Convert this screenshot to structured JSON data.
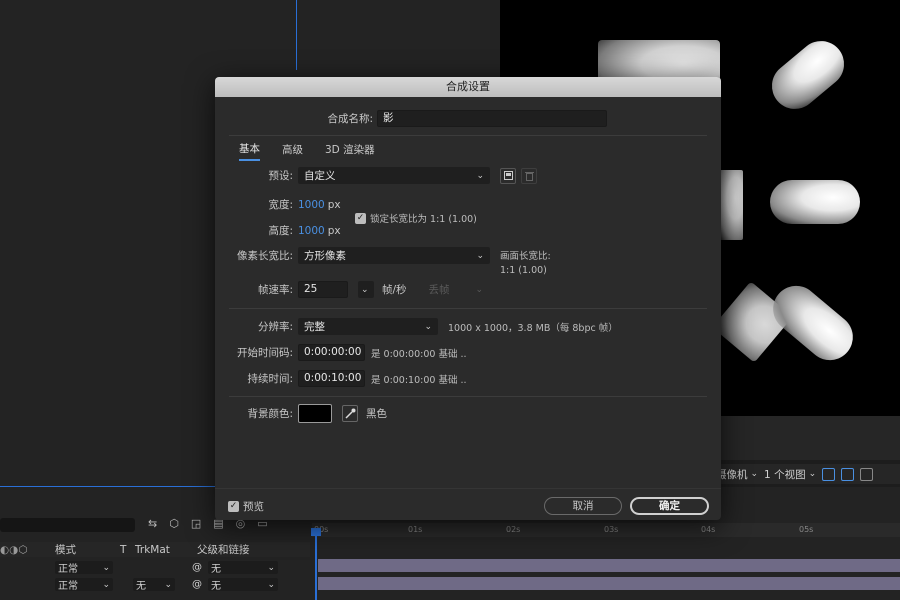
{
  "dialog": {
    "title": "合成设置",
    "name_label": "合成名称:",
    "name_value": "影",
    "tabs": [
      "基本",
      "高级",
      "3D 渲染器"
    ],
    "preset_label": "预设:",
    "preset_value": "自定义",
    "width_label": "宽度:",
    "width_value": "1000",
    "height_label": "高度:",
    "height_value": "1000",
    "unit_px": "px",
    "lock_label": "锁定长宽比为 1:1 (1.00)",
    "pixel_aspect_label": "像素长宽比:",
    "pixel_aspect_value": "方形像素",
    "frame_aspect_label": "画面长宽比:",
    "frame_aspect_value": "1:1 (1.00)",
    "framerate_label": "帧速率:",
    "framerate_value": "25",
    "framerate_unit": "帧/秒",
    "drop_frame_value": "丢帧",
    "resolution_label": "分辨率:",
    "resolution_value": "完整",
    "resolution_info": "1000 x 1000，3.8 MB（每 8bpc 帧）",
    "start_tc_label": "开始时间码:",
    "start_tc_value": "0:00:00:00",
    "start_tc_info": "是 0:00:00:00  基础 ..",
    "duration_label": "持续时间:",
    "duration_value": "0:00:10:00",
    "duration_info": "是 0:00:10:00  基础 ..",
    "bg_color_label": "背景颜色:",
    "bg_color_name": "黑色",
    "bg_color_hex": "#000000",
    "preview_label": "预览",
    "cancel_label": "取消",
    "ok_label": "确定"
  },
  "viewer": {
    "camera_label": "摄像机",
    "views_label": "1 个视图"
  },
  "timeline": {
    "ruler": [
      "00s",
      "01s",
      "02s",
      "03s",
      "04s",
      "05s"
    ],
    "col_mode": "模式",
    "col_t": "T",
    "col_trkmat": "TrkMat",
    "col_parent": "父级和链接",
    "rows": [
      {
        "mode": "正常",
        "trkmat": "",
        "parent": "无"
      },
      {
        "mode": "正常",
        "trkmat": "无",
        "parent": "无"
      }
    ]
  },
  "colors": {
    "accent": "#4a90e2",
    "dialog_bg": "#2b2b2b",
    "layer_bar": "#6f6a86"
  }
}
